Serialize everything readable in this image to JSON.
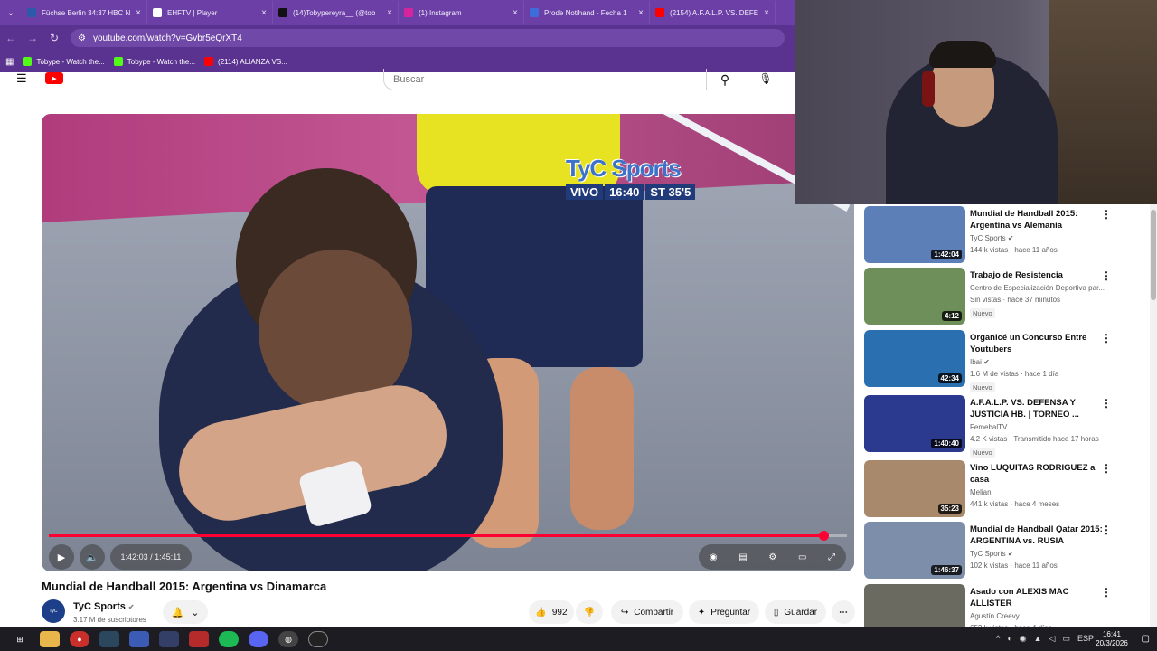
{
  "browser": {
    "tabs": [
      {
        "title": "Füchse Berlin 34:37 HBC N",
        "color": "#2a5aa8"
      },
      {
        "title": "EHFTV | Player",
        "color": "#ffffff"
      },
      {
        "title": "(14)Tobypereyra__ (@tob",
        "color": "#111111"
      },
      {
        "title": "(1) Instagram",
        "color": "#d6249f"
      },
      {
        "title": "Prode Notihand - Fecha 1",
        "color": "#3d6dd8"
      },
      {
        "title": "(2154) A.F.A.L.P. VS. DEFE",
        "color": "#ff0000"
      }
    ],
    "url": "youtube.com/watch?v=Gvbr5eQrXT4",
    "bookmarks": [
      {
        "label": "Tobype - Watch the...",
        "color": "#53fc18"
      },
      {
        "label": "Tobype - Watch the...",
        "color": "#53fc18"
      },
      {
        "label": "(2114) ALIANZA VS...",
        "color": "#ff0000"
      }
    ]
  },
  "youtube": {
    "search_placeholder": "Buscar",
    "logo_label": "YouTube"
  },
  "video": {
    "broadcaster": "TyC Sports",
    "live_label": "VIVO",
    "clock": "16:40",
    "score": "ST 35'5",
    "current_time": "1:42:03",
    "duration": "1:45:11",
    "time_display": "1:42:03 / 1:45:11",
    "progress": 0.9702,
    "title": "Mundial de Handball 2015: Argentina vs Dinamarca",
    "channel": "TyC Sports",
    "subscribers": "3.17 M de suscriptores",
    "likes": "992",
    "share_label": "Compartir",
    "ask_label": "Preguntar",
    "save_label": "Guardar"
  },
  "recommendations": [
    {
      "title": "Mundial de Handball 2015: Argentina vs Alemania",
      "channel": "TyC Sports",
      "verified": true,
      "meta": "144 k vistas · hace 11 años",
      "duration": "1:42:04",
      "badge": "",
      "thumb": "#5c7fb8"
    },
    {
      "title": "Trabajo de Resistencia",
      "channel": "Centro de Especialización Deportiva par...",
      "verified": false,
      "meta": "Sin vistas · hace 37 minutos",
      "duration": "4:12",
      "badge": "Nuevo",
      "thumb": "#6f8f5a"
    },
    {
      "title": "Organicé un Concurso Entre Youtubers",
      "channel": "Ibai",
      "verified": true,
      "meta": "1.6 M de vistas · hace 1 día",
      "duration": "42:34",
      "badge": "Nuevo",
      "thumb": "#2a6fb0"
    },
    {
      "title": "A.F.A.L.P. VS. DEFENSA Y JUSTICIA HB. | TORNEO ...",
      "channel": "FemebalTV",
      "verified": false,
      "meta": "4.2 K vistas · Transmitido hace 17 horas",
      "duration": "1:40:40",
      "badge": "Nuevo",
      "thumb": "#2b3a8f"
    },
    {
      "title": "Vino LUQUITAS RODRIGUEZ a casa",
      "channel": "Melian",
      "verified": false,
      "meta": "441 k vistas · hace 4 meses",
      "duration": "35:23",
      "badge": "",
      "thumb": "#a8896b"
    },
    {
      "title": "Mundial de Handball Qatar 2015: ARGENTINA vs. RUSIA",
      "channel": "TyC Sports",
      "verified": true,
      "meta": "102 k vistas · hace 11 años",
      "duration": "1:46:37",
      "badge": "",
      "thumb": "#7d8eaa"
    },
    {
      "title": "Asado con ALEXIS MAC ALLISTER",
      "channel": "Agustín Creevy",
      "verified": false,
      "meta": "653 k vistas · hace 4 días",
      "duration": "",
      "badge": "",
      "thumb": "#6b6a60"
    }
  ],
  "taskbar": {
    "lang": "ESP",
    "time": "16:41",
    "date": "20/3/2026"
  }
}
